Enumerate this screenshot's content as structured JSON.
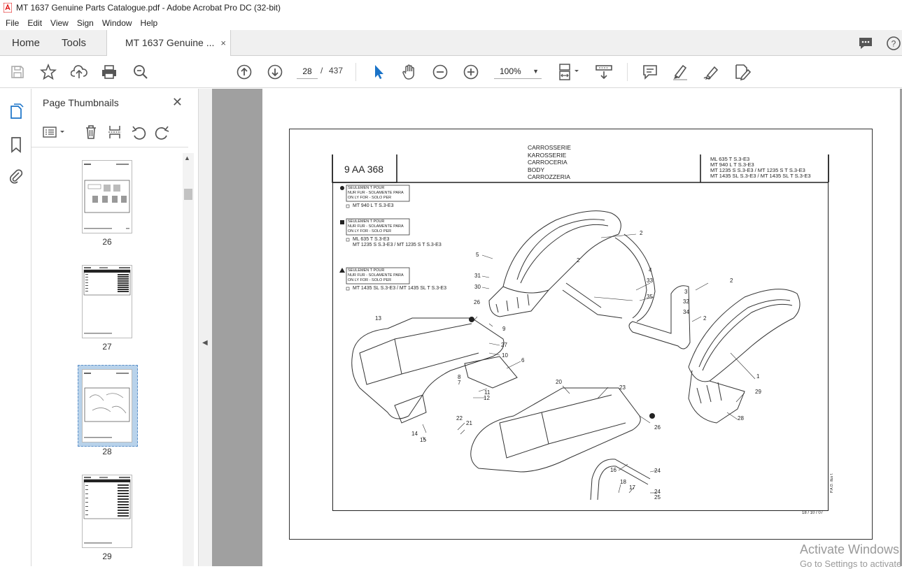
{
  "window": {
    "title": "MT 1637 Genuine Parts Catalogue.pdf - Adobe Acrobat Pro DC (32-bit)"
  },
  "menu": [
    "File",
    "Edit",
    "View",
    "Sign",
    "Window",
    "Help"
  ],
  "tabs": {
    "home": "Home",
    "tools": "Tools",
    "document": "MT 1637 Genuine ...",
    "close": "×"
  },
  "toolbar": {
    "current_page": "28",
    "separator": "/",
    "total_pages": "437",
    "zoom": "100%"
  },
  "panel": {
    "title": "Page Thumbnails",
    "close": "✕",
    "thumbnails": [
      {
        "label": "26"
      },
      {
        "label": "27"
      },
      {
        "label": "28",
        "selected": true
      },
      {
        "label": "29"
      }
    ]
  },
  "document_page": {
    "ref_code": "9 AA 368",
    "section_titles": [
      "CARROSSERIE",
      "KAROSSERIE",
      "CARROCERIA",
      "BODY",
      "CARROZZERIA"
    ],
    "models": [
      "ML 635 T S.3-E3",
      "MT 940 L T S.3-E3",
      "MT 1235 S S.3-E3 / MT 1235 S T S.3-E3",
      "MT 1435 SL S.3-E3 / MT 1435 SL T S.3-E3"
    ],
    "legend_box_lines": [
      "SEULEMEN   T POUR",
      "NUR FUR - SOLAMENTE      PARA",
      "ON LY FOR - SOLO PER"
    ],
    "legend_models": [
      "MT 940 L T S.3-E3",
      "ML 635 T S.3-E3",
      "MT 1235 S S.3-E3 / MT 1235 S T S.3-E3",
      "MT 1435 SL S.3-E3 / MT 1435 SL T S.3-E3"
    ],
    "callouts": [
      "2",
      "2",
      "2",
      "2",
      "4",
      "33",
      "35",
      "3",
      "32",
      "34",
      "5",
      "31",
      "30",
      "26",
      "9",
      "27",
      "10",
      "6",
      "8",
      "7",
      "11",
      "12",
      "13",
      "1",
      "29",
      "28",
      "20",
      "23",
      "26",
      "22",
      "21",
      "14",
      "15",
      "16",
      "18",
      "17",
      "24",
      "24",
      "25"
    ],
    "footer_date": "18 / 10 / 07",
    "side_note": "P.A.O. illus f."
  },
  "watermark": {
    "line1": "Activate Windows",
    "line2": "Go to Settings to activate Windows."
  },
  "colors": {
    "accent": "#1a73c8",
    "viewer_bg": "#a0a0a0",
    "selection": "#b8d2ea"
  }
}
